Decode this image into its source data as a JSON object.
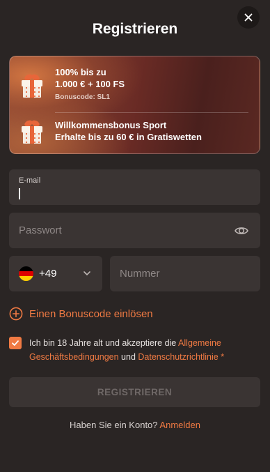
{
  "header": {
    "title": "Registrieren",
    "close_icon": "close-icon"
  },
  "promo": {
    "casino": {
      "line1": "100% bis zu",
      "line2": "1.000 € + 100 FS",
      "code_label": "Bonuscode: SL1",
      "icon": "gift-icon"
    },
    "sport": {
      "line1": "Willkommensbonus Sport",
      "line2": "Erhalte bis zu 60 € in Gratiswetten",
      "icon": "gift-icon"
    }
  },
  "form": {
    "email": {
      "label": "E-mail",
      "value": ""
    },
    "password": {
      "placeholder": "Passwort",
      "icon": "eye-icon"
    },
    "phone": {
      "country_flag": "germany-flag",
      "dial_code": "+49",
      "placeholder": "Nummer"
    },
    "bonus_link": {
      "label": "Einen Bonuscode einlösen",
      "icon": "plus-circle-icon"
    },
    "consent": {
      "checked": true,
      "text_before": "Ich bin 18 Jahre alt und akzeptiere die ",
      "terms_link": "Allgemeine Geschäftsbedingungen",
      "text_middle": " und ",
      "privacy_link": "Datenschutzrichtlinie",
      "required_mark": " *"
    },
    "submit_label": "REGISTRIEREN"
  },
  "footer": {
    "question": "Haben Sie ein Konto? ",
    "login_link": "Anmelden"
  },
  "colors": {
    "background": "#2a2524",
    "field": "#3a3433",
    "accent": "#f07a43"
  }
}
